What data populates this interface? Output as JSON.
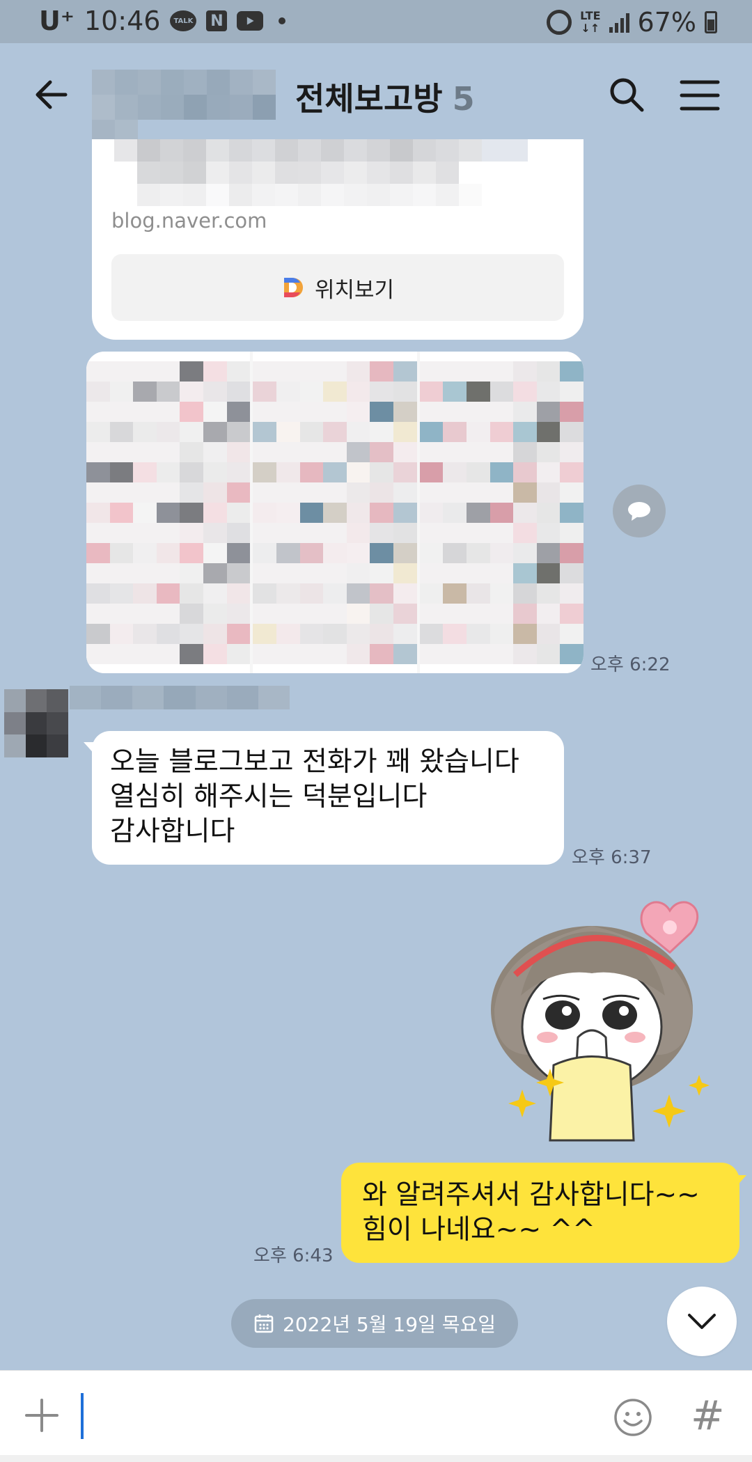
{
  "status_bar": {
    "carrier": "U⁺",
    "time": "10:46",
    "talk_icon_text": "TALK",
    "n_icon_text": "N",
    "network": "LTE",
    "battery": "67%"
  },
  "header": {
    "title": "전체보고방",
    "member_count": "5"
  },
  "link_card": {
    "domain": "blog.naver.com",
    "map_button_label": "위치보기"
  },
  "messages": {
    "image_time": "오후 6:22",
    "received": {
      "lines": [
        "오늘 블로그보고 전화가 꽤 왔습니다",
        "열심히 해주시는 덕분입니다",
        "감사합니다"
      ],
      "time": "오후 6:37"
    },
    "sent": {
      "lines": [
        "와 알려주셔서 감사합니다~~",
        "힘이 나네요~~ ^^"
      ],
      "time": "오후 6:43"
    }
  },
  "date_divider": "2022년 5월 19일 목요일",
  "input": {
    "value": "",
    "hash_label": "#"
  },
  "colors": {
    "chat_bg": "#b1c5da",
    "sent_bubble": "#fee33b",
    "received_bubble": "#ffffff",
    "date_pill": "#98aabc"
  }
}
